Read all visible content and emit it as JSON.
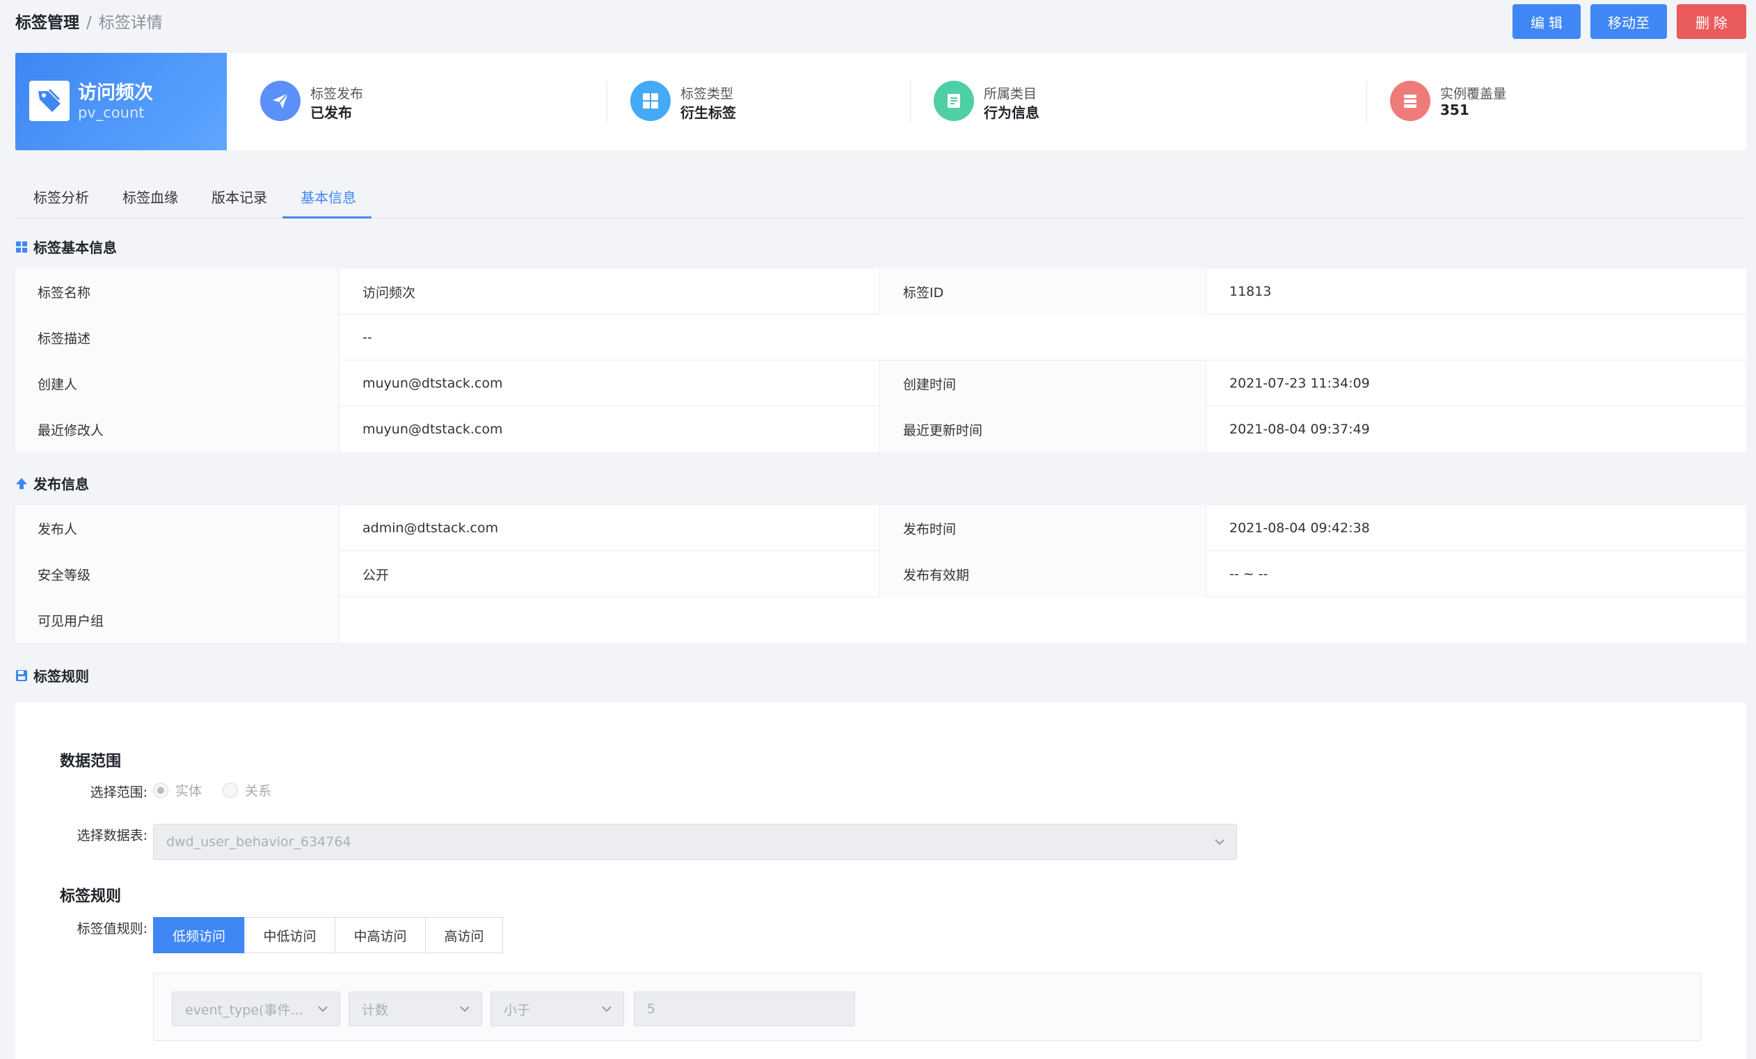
{
  "breadcrumb": {
    "parent": "标签管理",
    "separator": "/",
    "current": "标签详情"
  },
  "actions": {
    "edit": "编辑",
    "move": "移动至",
    "delete": "删除"
  },
  "header": {
    "tag_name": "访问频次",
    "tag_code": "pv_count",
    "stats": [
      {
        "label": "标签发布",
        "value": "已发布",
        "icon": "send-icon",
        "color": "#5b8ff9"
      },
      {
        "label": "标签类型",
        "value": "衍生标签",
        "icon": "grid-icon",
        "color": "#45a9f5"
      },
      {
        "label": "所属类目",
        "value": "行为信息",
        "icon": "document-icon",
        "color": "#4fcfa6"
      },
      {
        "label": "实例覆盖量",
        "value": "351",
        "icon": "database-icon",
        "color": "#ef7a7a"
      }
    ]
  },
  "tabs": [
    "标签分析",
    "标签血缘",
    "版本记录",
    "基本信息"
  ],
  "active_tab": "基本信息",
  "basic_info": {
    "title": "标签基本信息",
    "rows": [
      {
        "k1": "标签名称",
        "v1": "访问频次",
        "k2": "标签ID",
        "v2": "11813"
      },
      {
        "k1": "标签描述",
        "v1": "--"
      },
      {
        "k1": "创建人",
        "v1": "muyun@dtstack.com",
        "k2": "创建时间",
        "v2": "2021-07-23 11:34:09"
      },
      {
        "k1": "最近修改人",
        "v1": "muyun@dtstack.com",
        "k2": "最近更新时间",
        "v2": "2021-08-04 09:37:49"
      }
    ]
  },
  "publish_info": {
    "title": "发布信息",
    "rows": [
      {
        "k1": "发布人",
        "v1": "admin@dtstack.com",
        "k2": "发布时间",
        "v2": "2021-08-04 09:42:38"
      },
      {
        "k1": "安全等级",
        "v1": "公开",
        "k2": "发布有效期",
        "v2": "-- ~ --"
      },
      {
        "k1": "可见用户组",
        "v1": ""
      }
    ]
  },
  "rules": {
    "title": "标签规则",
    "data_scope_title": "数据范围",
    "scope_label": "选择范围:",
    "scope_options": [
      "实体",
      "关系"
    ],
    "scope_selected": "实体",
    "table_label": "选择数据表:",
    "table_value": "dwd_user_behavior_634764",
    "rule_title": "标签规则",
    "value_rule_label": "标签值规则:",
    "value_rules": [
      "低频访问",
      "中低访问",
      "中高访问",
      "高访问"
    ],
    "value_rule_selected": "低频访问",
    "condition": {
      "field": "event_type(事件...",
      "agg": "计数",
      "op": "小于",
      "value": "5"
    }
  }
}
